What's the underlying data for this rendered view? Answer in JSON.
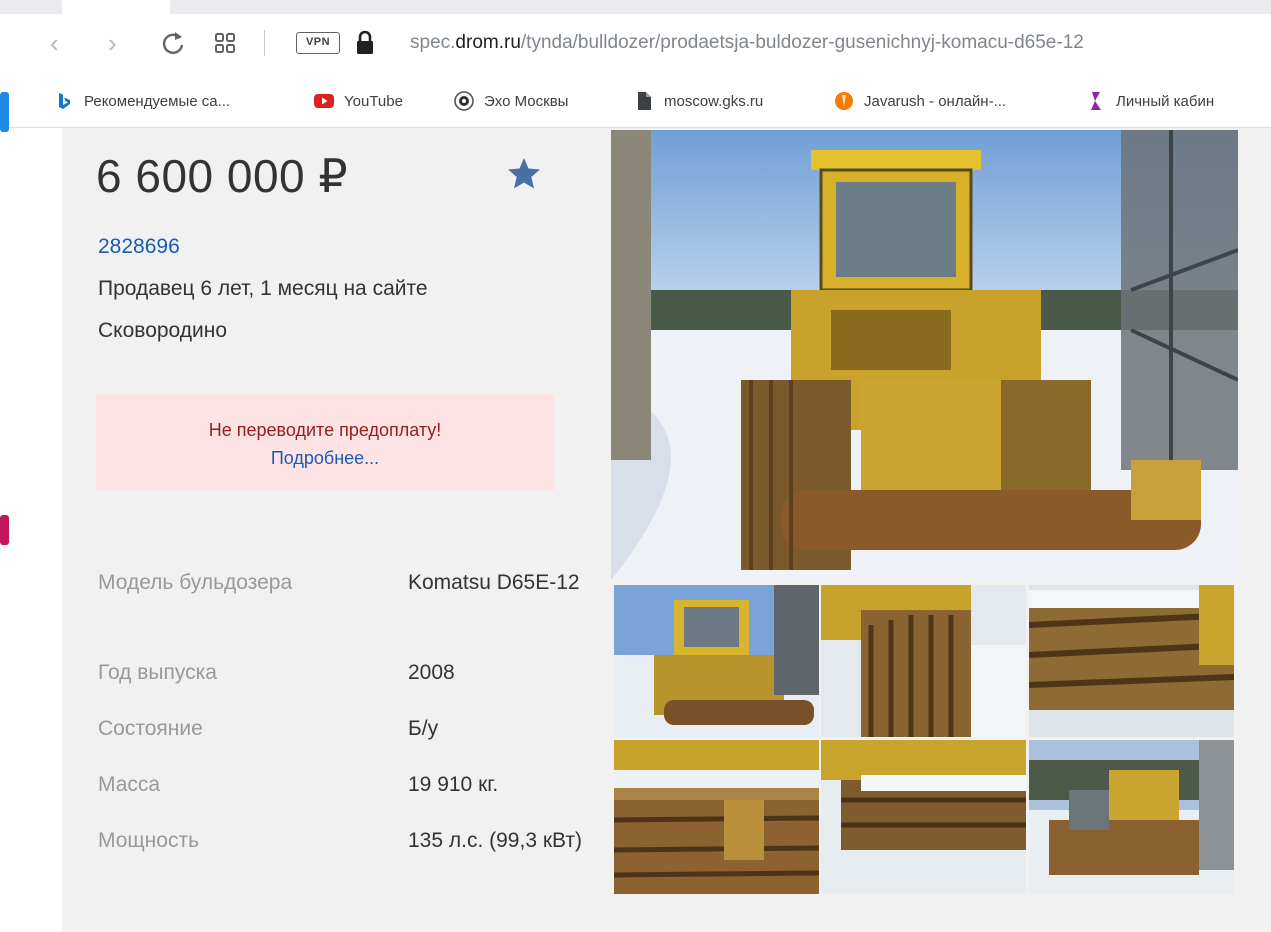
{
  "browser": {
    "nav": {
      "back_glyph": "‹",
      "forward_glyph": "›"
    },
    "vpn_label": "VPN",
    "url": {
      "prefix": "spec.",
      "domain": "drom.ru",
      "path": "/tynda/bulldozer/prodaetsja-buldozer-gusenichnyj-komacu-d65e-12"
    },
    "bookmarks": [
      {
        "label": "Рекомендуемые са...",
        "icon": "bing-icon"
      },
      {
        "label": "YouTube",
        "icon": "youtube-icon"
      },
      {
        "label": "Эхо Москвы",
        "icon": "echo-moscow-icon"
      },
      {
        "label": "moscow.gks.ru",
        "icon": "document-icon"
      },
      {
        "label": "Javarush - онлайн-...",
        "icon": "javarush-icon"
      },
      {
        "label": "Личный кабин",
        "icon": "purple-bookmark-icon"
      }
    ]
  },
  "listing": {
    "price": "6 600 000 ₽",
    "seller_id": "2828696",
    "seller_info": "Продавец 6 лет, 1 месяц на сайте",
    "city": "Сковородино",
    "warning": {
      "title": "Не переводите предоплату!",
      "link": "Подробнее..."
    },
    "specs": [
      {
        "label": "Модель бульдозера",
        "value": "Komatsu D65E-12"
      },
      {
        "label": "Год выпуска",
        "value": "2008"
      },
      {
        "label": "Состояние",
        "value": "Б/у"
      },
      {
        "label": "Масса",
        "value": "19 910 кг."
      },
      {
        "label": "Мощность",
        "value": "135 л.с. (99,3 кВт)"
      }
    ],
    "photos": {
      "main": "bulldozer-rear-view",
      "thumbnails": [
        "bulldozer-rear-thumbnail",
        "track-side-thumbnail",
        "track-closeup-thumbnail",
        "blade-closeup-thumbnail",
        "track-snow-thumbnail",
        "bulldozer-front-thumbnail"
      ]
    }
  },
  "colors": {
    "link": "#1a5bb4",
    "warning_bg": "#fde3e3",
    "warning_text": "#9a1b1b",
    "panel_bg": "#f1f1f1",
    "star": "#4a6fa5",
    "bulldozer_yellow": "#e8c23a"
  }
}
